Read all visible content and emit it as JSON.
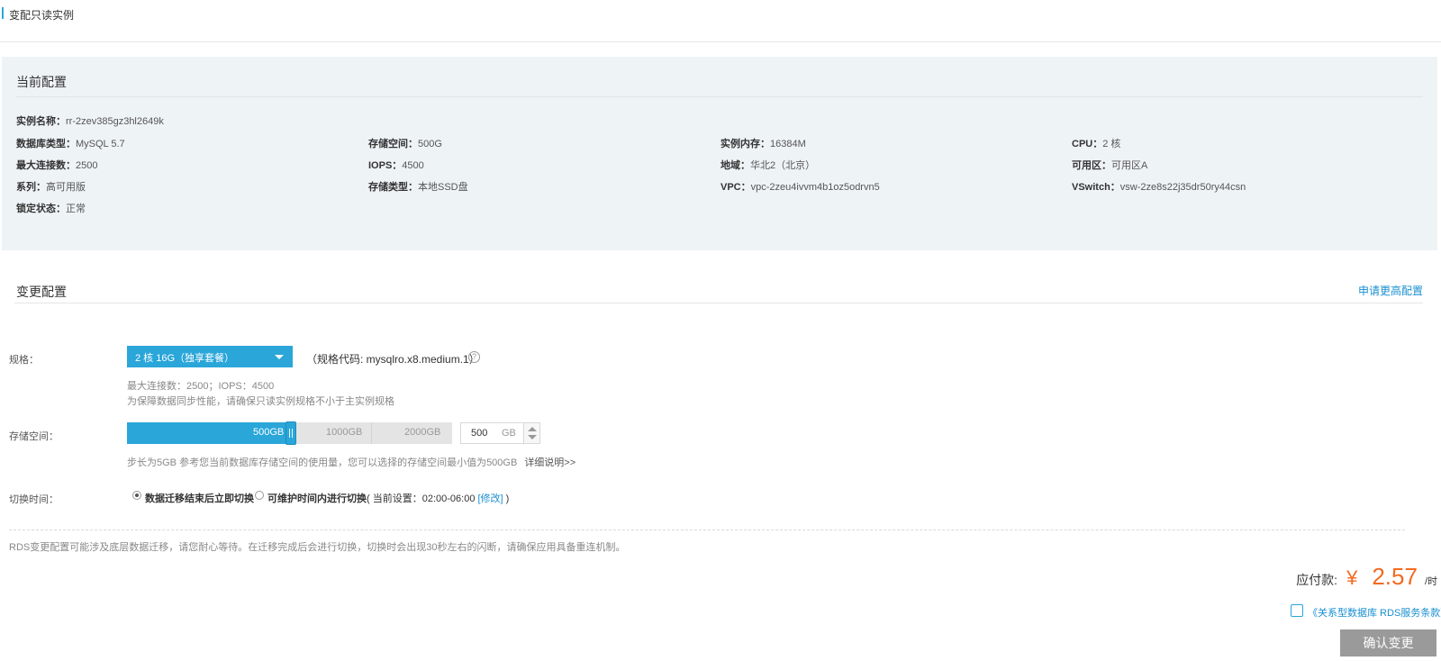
{
  "header": {
    "title": "变配只读实例"
  },
  "current_config": {
    "title": "当前配置",
    "instance_name": {
      "label": "实例名称：",
      "value": "rr-2zev385gz3hl2649k"
    },
    "db_type": {
      "label": "数据库类型：",
      "value": "MySQL 5.7"
    },
    "storage": {
      "label": "存储空间：",
      "value": "500G"
    },
    "memory": {
      "label": "实例内存：",
      "value": "16384M"
    },
    "cpu": {
      "label": "CPU：",
      "value": "2 核"
    },
    "max_conn": {
      "label": "最大连接数：",
      "value": "2500"
    },
    "iops": {
      "label": "IOPS：",
      "value": "4500"
    },
    "region": {
      "label": "地域：",
      "value": "华北2（北京）"
    },
    "zone": {
      "label": "可用区：",
      "value": "可用区A"
    },
    "series": {
      "label": "系列：",
      "value": "高可用版"
    },
    "storage_type": {
      "label": "存储类型：",
      "value": "本地SSD盘"
    },
    "vpc": {
      "label": "VPC：",
      "value": "vpc-2zeu4ivvm4b1oz5odrvn5"
    },
    "vswitch": {
      "label": "VSwitch：",
      "value": "vsw-2ze8s22j35dr50ry44csn"
    },
    "lock_status": {
      "label": "锁定状态：",
      "value": "正常"
    }
  },
  "change_config": {
    "title": "变更配置",
    "upgrade_link": "申请更高配置",
    "spec": {
      "label": "规格：",
      "selected": "2 核 16G（独享套餐）",
      "code": "（规格代码: mysqlro.x8.medium.1）",
      "hint1": "最大连接数：2500；IOPS：4500",
      "hint2": "为保障数据同步性能，请确保只读实例规格不小于主实例规格"
    },
    "storage": {
      "label": "存储空间：",
      "ticks": [
        "500GB",
        "1000GB",
        "2000GB"
      ],
      "value": "500",
      "unit": "GB",
      "slider_fraction": 0.0,
      "hint": "步长为5GB 参考您当前数据库存储空间的使用量，您可以选择的存储空间最小值为500GB",
      "more": "详细说明>>"
    },
    "switch_time": {
      "label": "切换时间：",
      "option1": "数据迁移结束后立即切换",
      "option2": "可维护时间内进行切换",
      "current_prefix": "( 当前设置：02:00-06:00 ",
      "modify": "[修改]",
      "current_suffix": " )"
    }
  },
  "notice": "RDS变更配置可能涉及底层数据迁移，请您耐心等待。在迁移完成后会进行切换，切换时会出现30秒左右的闪断，请确保应用具备重连机制。",
  "price": {
    "label": "应付款:",
    "currency": "¥",
    "amount": "2.57",
    "unit": "/时"
  },
  "agreement": "《关系型数据库 RDS服务条款》",
  "confirm_button": "确认变更",
  "colors": {
    "accent": "#2aa6d9",
    "price": "#f36a21",
    "link": "#1a8fd0",
    "panel_bg": "#eef3f6"
  }
}
